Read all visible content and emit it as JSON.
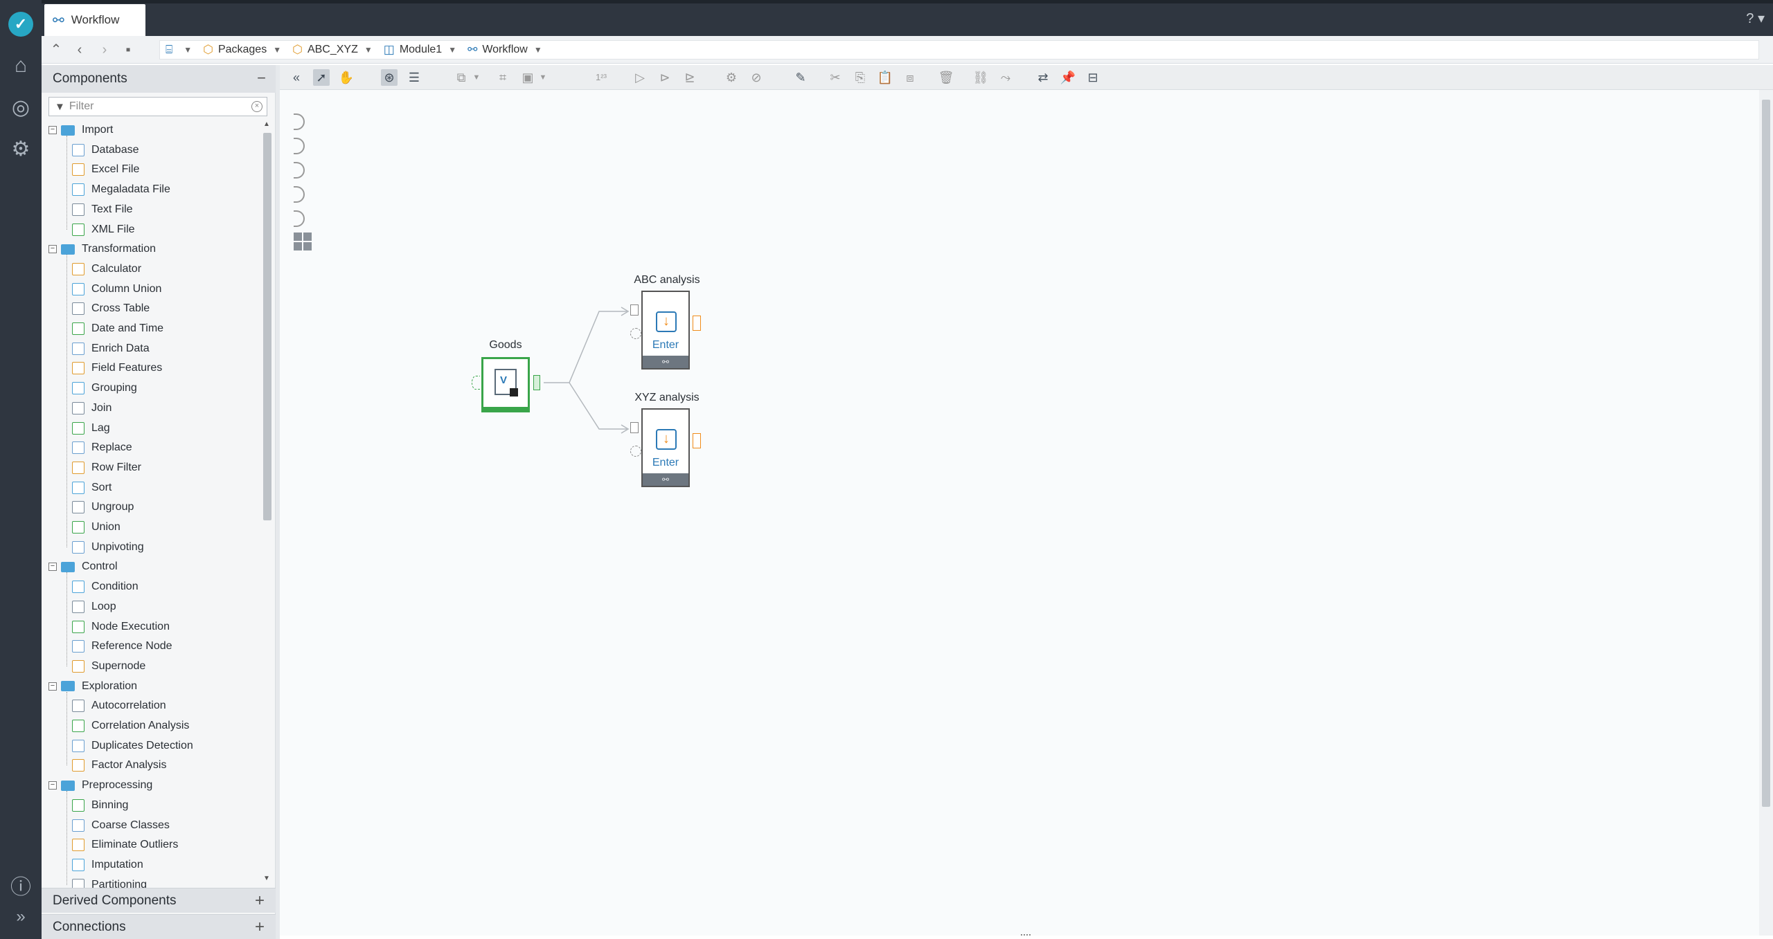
{
  "app": {
    "rail_icons": [
      "app-logo",
      "graduation-cap-icon",
      "compass-icon",
      "gear-icon",
      "info-icon",
      "expand-chevrons-icon"
    ],
    "tab_title": "Workflow",
    "help": "?"
  },
  "breadcrumb": {
    "items": [
      {
        "label": "Packages",
        "icon": "package-icon"
      },
      {
        "label": "ABC_XYZ",
        "icon": "package-icon"
      },
      {
        "label": "Module1",
        "icon": "module-icon"
      },
      {
        "label": "Workflow",
        "icon": "workflow-icon"
      }
    ]
  },
  "components_panel": {
    "title": "Components",
    "toggle": "−",
    "filter_placeholder": "Filter",
    "categories": [
      {
        "label": "Import",
        "items": [
          "Database",
          "Excel File",
          "Megaladata File",
          "Text File",
          "XML File"
        ]
      },
      {
        "label": "Transformation",
        "items": [
          "Calculator",
          "Column Union",
          "Cross Table",
          "Date and Time",
          "Enrich Data",
          "Field Features",
          "Grouping",
          "Join",
          "Lag",
          "Replace",
          "Row Filter",
          "Sort",
          "Ungroup",
          "Union",
          "Unpivoting"
        ]
      },
      {
        "label": "Control",
        "items": [
          "Condition",
          "Loop",
          "Node Execution",
          "Reference Node",
          "Supernode"
        ]
      },
      {
        "label": "Exploration",
        "items": [
          "Autocorrelation",
          "Correlation Analysis",
          "Duplicates Detection",
          "Factor Analysis"
        ]
      },
      {
        "label": "Preprocessing",
        "items": [
          "Binning",
          "Coarse Classes",
          "Eliminate Outliers",
          "Imputation",
          "Partitioning"
        ]
      }
    ]
  },
  "derived_components": {
    "title": "Derived Components",
    "toggle": "+"
  },
  "connections": {
    "title": "Connections",
    "toggle": "+"
  },
  "workflow": {
    "nodes": [
      {
        "title": "Goods"
      },
      {
        "title": "ABC analysis",
        "label": "Enter"
      },
      {
        "title": "XYZ analysis",
        "label": "Enter"
      }
    ]
  },
  "colors": {
    "accent": "#2b79b6",
    "node_ok": "#3aa54a",
    "port_orange": "#f08c1a",
    "rail": "#2f3640"
  }
}
